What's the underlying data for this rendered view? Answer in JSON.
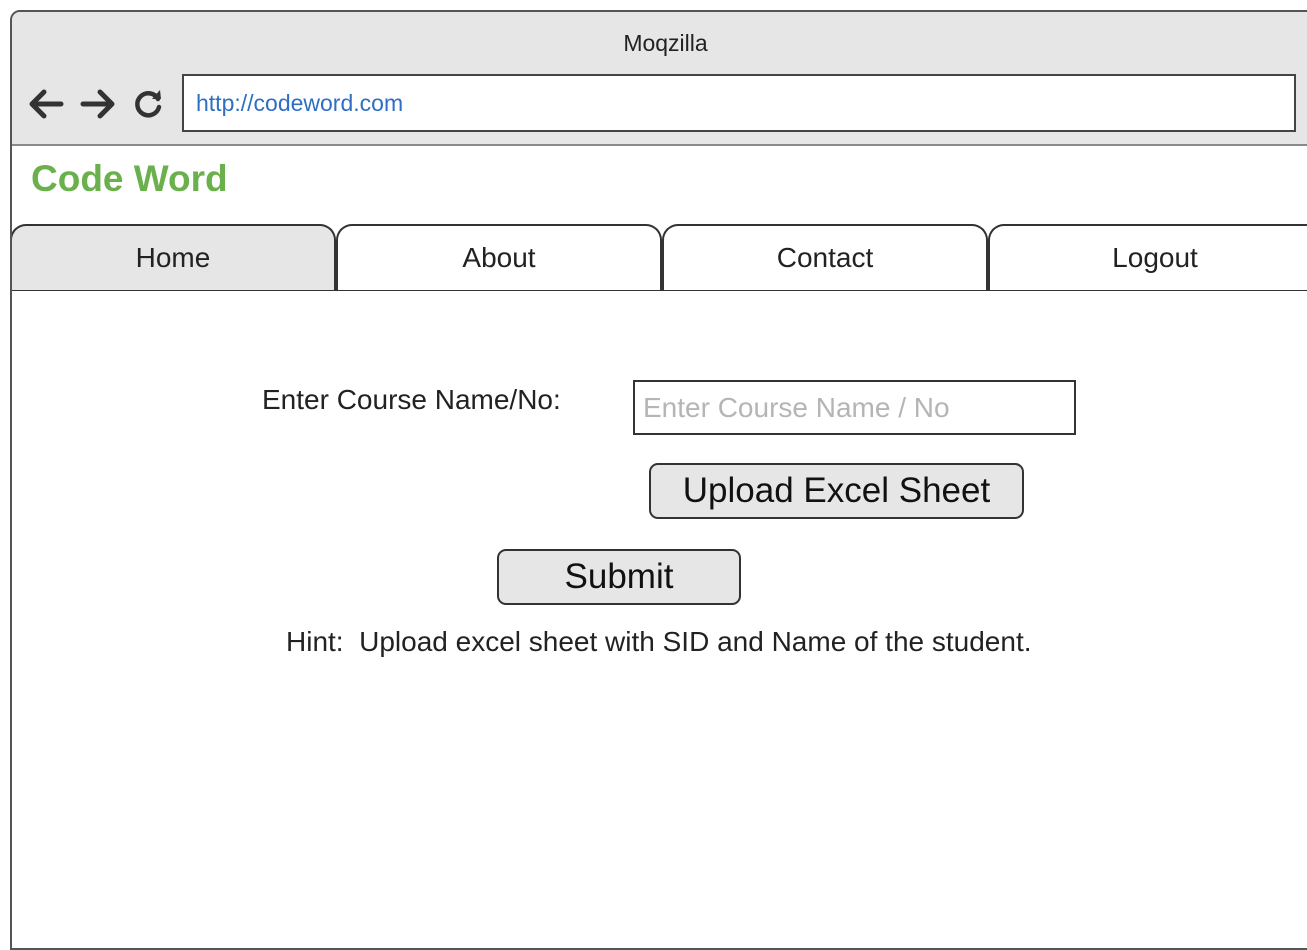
{
  "browser": {
    "title": "Moqzilla",
    "url": "http://codeword.com",
    "icons": {
      "back": "arrow-left-icon",
      "forward": "arrow-right-icon",
      "reload": "reload-icon"
    }
  },
  "site": {
    "brand": "Code Word",
    "brand_color": "#6ab04c"
  },
  "tabs": [
    {
      "label": "Home",
      "active": true
    },
    {
      "label": "About",
      "active": false
    },
    {
      "label": "Contact",
      "active": false
    },
    {
      "label": "Logout",
      "active": false
    }
  ],
  "form": {
    "course_label": "Enter Course Name/No:",
    "course_placeholder": "Enter Course Name / No",
    "course_value": "",
    "upload_label": "Upload Excel Sheet",
    "submit_label": "Submit",
    "hint": "Hint:  Upload excel sheet with SID and Name of the student."
  }
}
